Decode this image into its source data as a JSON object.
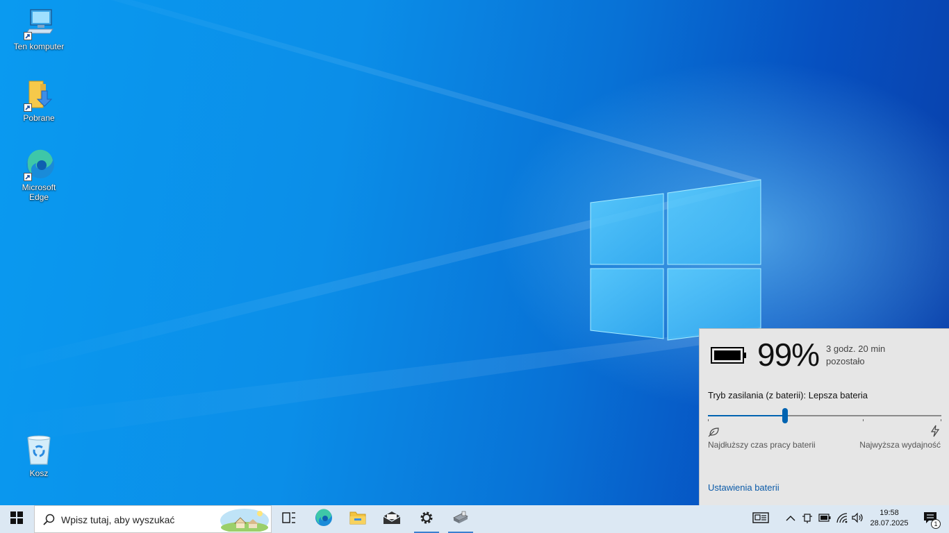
{
  "desktop": {
    "icons": [
      {
        "label": "Ten komputer",
        "icon": "computer-icon"
      },
      {
        "label": "Pobrane",
        "icon": "downloads-folder-icon"
      },
      {
        "label": "Microsoft Edge",
        "icon": "edge-icon"
      },
      {
        "label": "Kosz",
        "icon": "recycle-bin-icon"
      }
    ]
  },
  "battery_flyout": {
    "percent": "99%",
    "percent_value": 99,
    "remaining_line1": "3 godz. 20 min",
    "remaining_line2": "pozostało",
    "power_mode_label": "Tryb zasilania (z baterii): Lepsza bateria",
    "slider_level": 0.33,
    "left_label": "Najdłuższy czas pracy baterii",
    "right_label": "Najwyższa wydajność",
    "settings_link": "Ustawienia baterii",
    "accent_color": "#0063b1"
  },
  "taskbar": {
    "search_placeholder": "Wpisz tutaj, aby wyszukać",
    "pinned": [
      "task-view-icon",
      "edge-icon",
      "file-explorer-icon",
      "mail-icon",
      "settings-icon",
      "app-icon"
    ],
    "tray": {
      "time": "19:58",
      "date": "28.07.2025",
      "notification_count": "1"
    }
  }
}
